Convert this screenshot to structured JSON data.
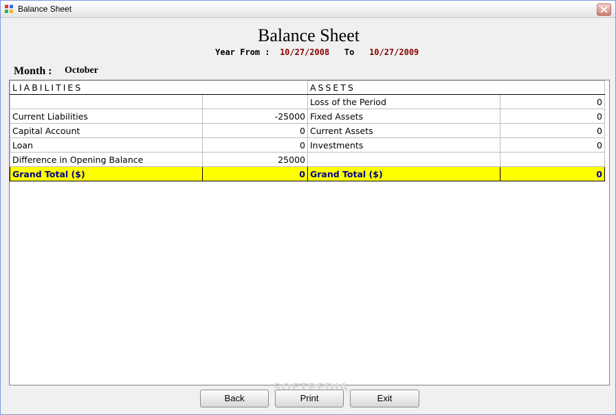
{
  "window": {
    "title": "Balance Sheet"
  },
  "header": {
    "title": "Balance Sheet",
    "year_from_label": "Year From :",
    "from_date": "10/27/2008",
    "to_label": "To",
    "to_date": "10/27/2009",
    "month_label": "Month :",
    "month_value": "October"
  },
  "table": {
    "liabilities_header": "LIABILITIES",
    "assets_header": "ASSETS",
    "rows": [
      {
        "liab_label": "",
        "liab_value": "",
        "asset_label": "Loss of the Period",
        "asset_value": "0"
      },
      {
        "liab_label": "Current Liabilities",
        "liab_value": "-25000",
        "asset_label": "Fixed Assets",
        "asset_value": "0"
      },
      {
        "liab_label": "Capital Account",
        "liab_value": "0",
        "asset_label": "Current Assets",
        "asset_value": "0"
      },
      {
        "liab_label": "Loan",
        "liab_value": "0",
        "asset_label": "Investments",
        "asset_value": "0"
      },
      {
        "liab_label": "Difference in Opening Balance",
        "liab_value": "25000",
        "asset_label": "",
        "asset_value": ""
      }
    ],
    "total": {
      "liab_label": "Grand Total ($)",
      "liab_value": "0",
      "asset_label": "Grand Total ($)",
      "asset_value": "0"
    }
  },
  "buttons": {
    "back": "Back",
    "print": "Print",
    "exit": "Exit"
  },
  "watermark": "SOFTPEDIA",
  "colors": {
    "total_row_bg": "#FFFF00",
    "total_row_text": "#00008B",
    "date_text": "#8B0000"
  },
  "icons": {
    "app": "app-icon",
    "close": "close-icon"
  }
}
